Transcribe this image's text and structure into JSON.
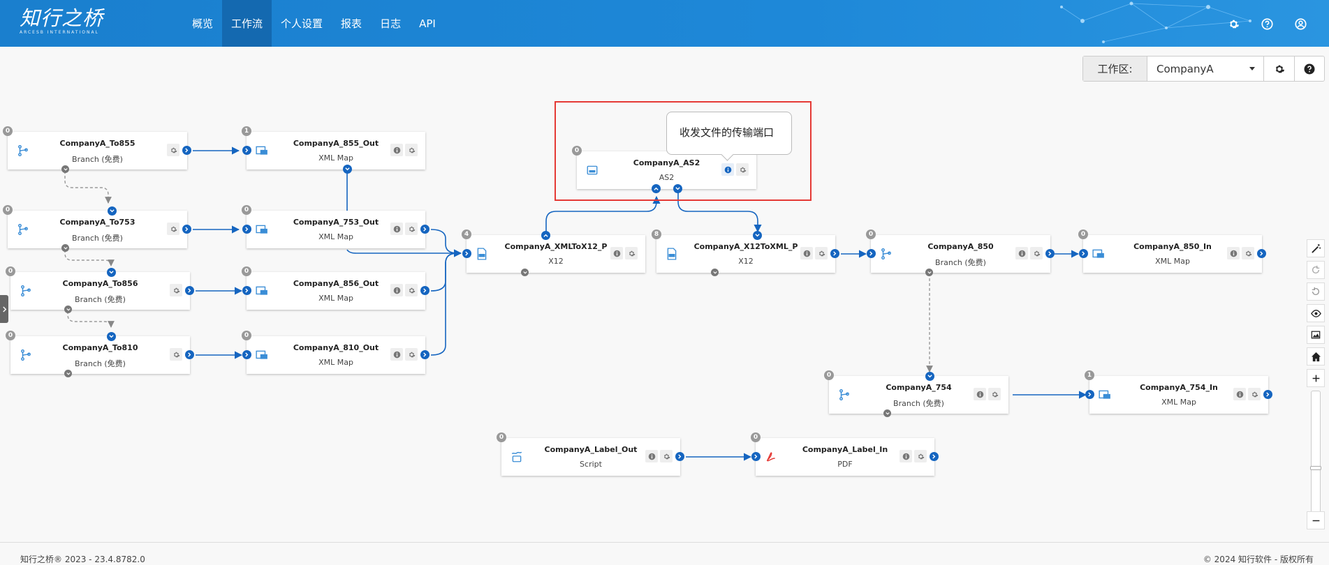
{
  "header": {
    "logo_text": "知行之桥",
    "logo_sub": "ARCESB INTERNATIONAL",
    "nav": [
      {
        "label": "概览",
        "active": false
      },
      {
        "label": "工作流",
        "active": true
      },
      {
        "label": "个人设置",
        "active": false
      },
      {
        "label": "报表",
        "active": false
      },
      {
        "label": "日志",
        "active": false
      },
      {
        "label": "API",
        "active": false
      }
    ],
    "icons": [
      "gear-icon",
      "help-icon",
      "user-icon"
    ]
  },
  "workspace": {
    "label": "工作区:",
    "selected": "CompanyA"
  },
  "tooltip": "收发文件的传输端口",
  "nodes": [
    {
      "id": "n1",
      "title": "CompanyA_To855",
      "subtitle": "Branch (免费)",
      "badge": "0",
      "type": "branch"
    },
    {
      "id": "n2",
      "title": "CompanyA_855_Out",
      "subtitle": "XML Map",
      "badge": "1",
      "type": "xmlmap"
    },
    {
      "id": "n3",
      "title": "CompanyA_To753",
      "subtitle": "Branch (免费)",
      "badge": "0",
      "type": "branch"
    },
    {
      "id": "n4",
      "title": "CompanyA_753_Out",
      "subtitle": "XML Map",
      "badge": "0",
      "type": "xmlmap"
    },
    {
      "id": "n5",
      "title": "CompanyA_To856",
      "subtitle": "Branch (免费)",
      "badge": "0",
      "type": "branch"
    },
    {
      "id": "n6",
      "title": "CompanyA_856_Out",
      "subtitle": "XML Map",
      "badge": "0",
      "type": "xmlmap"
    },
    {
      "id": "n7",
      "title": "CompanyA_To810",
      "subtitle": "Branch (免费)",
      "badge": "0",
      "type": "branch"
    },
    {
      "id": "n8",
      "title": "CompanyA_810_Out",
      "subtitle": "XML Map",
      "badge": "0",
      "type": "xmlmap"
    },
    {
      "id": "n9",
      "title": "CompanyA_AS2",
      "subtitle": "AS2",
      "badge": "0",
      "type": "as2"
    },
    {
      "id": "n10",
      "title": "CompanyA_XMLToX12_P",
      "subtitle": "X12",
      "badge": "4",
      "type": "x12"
    },
    {
      "id": "n11",
      "title": "CompanyA_X12ToXML_P",
      "subtitle": "X12",
      "badge": "8",
      "type": "x12"
    },
    {
      "id": "n12",
      "title": "CompanyA_850",
      "subtitle": "Branch (免费)",
      "badge": "0",
      "type": "branch"
    },
    {
      "id": "n13",
      "title": "CompanyA_850_In",
      "subtitle": "XML Map",
      "badge": "0",
      "type": "xmlmap"
    },
    {
      "id": "n14",
      "title": "CompanyA_754",
      "subtitle": "Branch (免费)",
      "badge": "0",
      "type": "branch"
    },
    {
      "id": "n15",
      "title": "CompanyA_754_In",
      "subtitle": "XML Map",
      "badge": "1",
      "type": "xmlmap"
    },
    {
      "id": "n16",
      "title": "CompanyA_Label_Out",
      "subtitle": "Script",
      "badge": "0",
      "type": "script"
    },
    {
      "id": "n17",
      "title": "CompanyA_Label_In",
      "subtitle": "PDF",
      "badge": "0",
      "type": "pdf"
    }
  ],
  "footer": {
    "left": "知行之桥® 2023 - 23.4.8782.0",
    "right": "© 2024 知行软件 - 版权所有"
  },
  "colors": {
    "header": "#1e88d8",
    "nav_active": "#1469b0",
    "port": "#1565c0",
    "edge": "#1565c0",
    "highlight": "#e53935"
  }
}
